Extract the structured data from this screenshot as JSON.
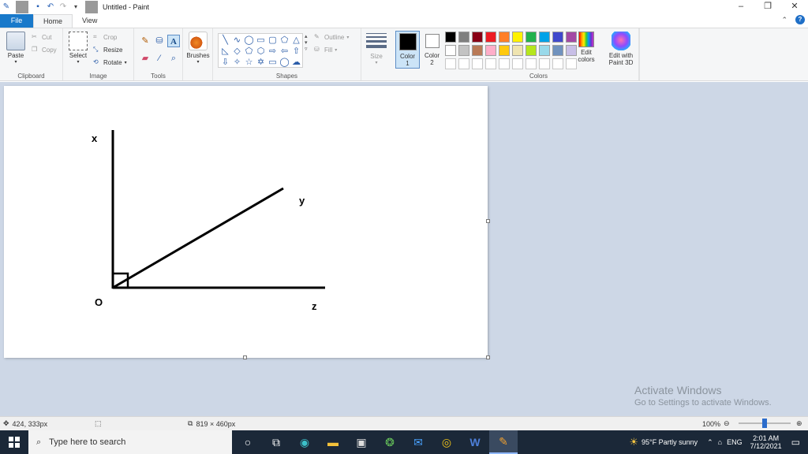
{
  "window": {
    "title": "Untitled - Paint"
  },
  "tabs": [
    {
      "label": "File"
    },
    {
      "label": "Home"
    },
    {
      "label": "View"
    }
  ],
  "ribbon": {
    "clipboard": {
      "paste_label": "Paste",
      "cut_label": "Cut",
      "copy_label": "Copy",
      "group_label": "Clipboard"
    },
    "image": {
      "select_label": "Select",
      "crop_label": "Crop",
      "resize_label": "Resize",
      "rotate_label": "Rotate",
      "group_label": "Image"
    },
    "tools": {
      "group_label": "Tools",
      "active_tool": "text-tool"
    },
    "brushes": {
      "label": "Brushes"
    },
    "shapes": {
      "outline_label": "Outline",
      "fill_label": "Fill",
      "group_label": "Shapes"
    },
    "size": {
      "label": "Size"
    },
    "color1": {
      "label_line1": "Color",
      "label_line2": "1",
      "value": "#000000"
    },
    "color2": {
      "label_line1": "Color",
      "label_line2": "2",
      "value": "#ffffff"
    },
    "colors": {
      "group_label": "Colors",
      "edit_label_line1": "Edit",
      "edit_label_line2": "colors",
      "palette": [
        "#000000",
        "#7f7f7f",
        "#880015",
        "#ed1c24",
        "#ff7f27",
        "#fff200",
        "#22b14c",
        "#00a2e8",
        "#3f48cc",
        "#a349a4",
        "#ffffff",
        "#c3c3c3",
        "#b97a57",
        "#ffaec9",
        "#ffc90e",
        "#efe4b0",
        "#b5e61d",
        "#99d9ea",
        "#7092be",
        "#c8bfe7",
        "#ffffff",
        "#ffffff",
        "#ffffff",
        "#ffffff",
        "#ffffff",
        "#ffffff",
        "#ffffff",
        "#ffffff",
        "#ffffff",
        "#ffffff"
      ]
    },
    "paint3d": {
      "label_line1": "Edit with",
      "label_line2": "Paint 3D"
    }
  },
  "canvas": {
    "labels": {
      "x": "x",
      "y": "y",
      "z": "z",
      "o": "O"
    }
  },
  "watermark": {
    "line1": "Activate Windows",
    "line2": "Go to Settings to activate Windows."
  },
  "status": {
    "cursor_pos": "424, 333px",
    "selection_size": "",
    "image_size": "819 × 460px",
    "zoom": "100%"
  },
  "taskbar": {
    "search_placeholder": "Type here to search",
    "weather": "95°F  Partly sunny",
    "language": "ENG",
    "time": "2:01 AM",
    "date": "7/12/2021"
  }
}
